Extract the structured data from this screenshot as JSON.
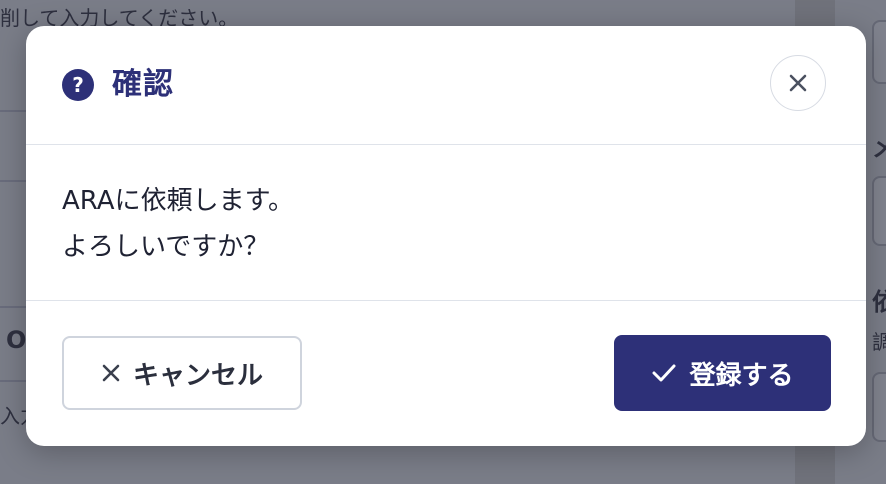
{
  "background": {
    "hint_text": "削して入力してください。",
    "fragments": {
      "left_mid": "O",
      "left_bottom": "入力",
      "right_top": "メ",
      "right_mid": "依",
      "right_low": "調"
    }
  },
  "dialog": {
    "title": "確認",
    "title_icon": "question-circle-icon",
    "close_icon": "close-icon",
    "message_lines": [
      "ARAに依頼します。",
      "よろしいですか？"
    ],
    "cancel_label": "キャンセル",
    "cancel_icon": "close-icon",
    "submit_label": "登録する",
    "submit_icon": "check-icon"
  },
  "colors": {
    "primary": "#2d3078",
    "text": "#1f2233",
    "border": "#dfe3ea"
  }
}
